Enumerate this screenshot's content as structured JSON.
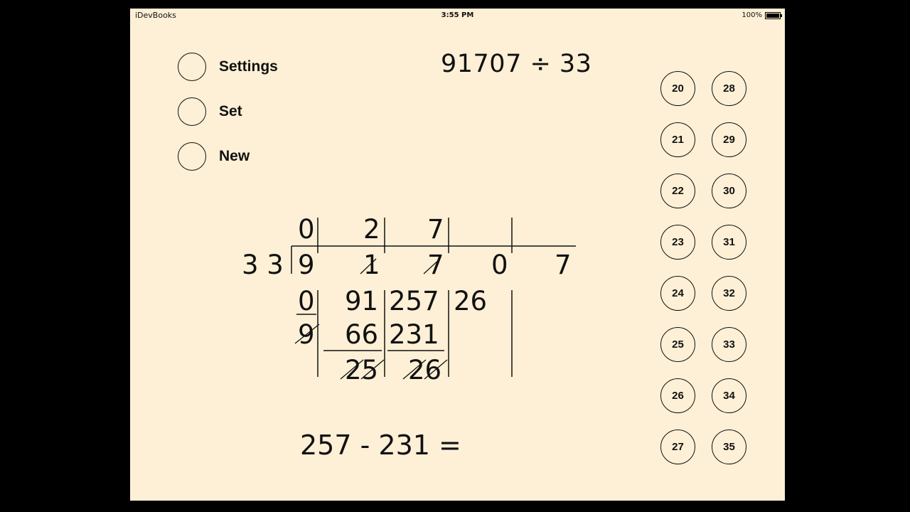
{
  "status_bar": {
    "carrier": "iDevBooks",
    "time": "3:55 PM",
    "battery": "100%"
  },
  "menu": [
    {
      "label": "Settings"
    },
    {
      "label": "Set"
    },
    {
      "label": "New"
    }
  ],
  "problem": "91707 ÷ 33",
  "equation": "257 - 231 =",
  "division": {
    "divisor": "3 3",
    "quotient": [
      "0",
      "2",
      "7"
    ],
    "dividend": [
      "9",
      "1",
      "7",
      "0",
      "7"
    ],
    "col1": [
      "0",
      "9"
    ],
    "col2": [
      "91",
      "66",
      "25"
    ],
    "col3": [
      "257",
      "231",
      "26"
    ],
    "col4": [
      "26"
    ]
  },
  "number_buttons": [
    "20",
    "21",
    "22",
    "23",
    "24",
    "25",
    "26",
    "27",
    "28",
    "29",
    "30",
    "31",
    "32",
    "33",
    "34",
    "35"
  ]
}
